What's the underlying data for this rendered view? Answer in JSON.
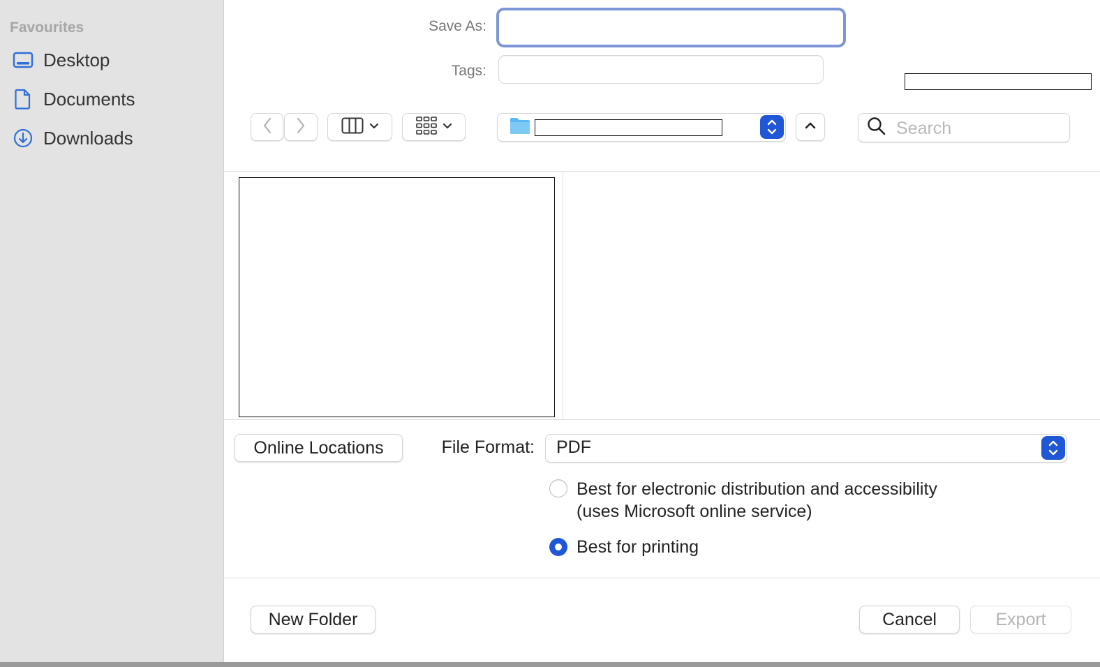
{
  "sidebar": {
    "heading": "Favourites",
    "items": [
      {
        "label": "Desktop",
        "icon": "desktop-icon"
      },
      {
        "label": "Documents",
        "icon": "document-icon"
      },
      {
        "label": "Downloads",
        "icon": "download-icon"
      }
    ]
  },
  "form": {
    "save_as_label": "Save As:",
    "save_as_value": "",
    "tags_label": "Tags:"
  },
  "toolbar": {
    "back_icon": "chevron-left-icon",
    "forward_icon": "chevron-right-icon",
    "column_view_icon": "columns-icon",
    "group_icon": "grid-icon",
    "location_icon": "folder-icon",
    "location_name": "",
    "expand_icon": "chevron-up-icon",
    "search_placeholder": "Search"
  },
  "options": {
    "online_locations_label": "Online Locations",
    "file_format_label": "File Format:",
    "file_format_value": "PDF",
    "radio_options": [
      {
        "line1": "Best for electronic distribution and accessibility",
        "line2": "(uses Microsoft online service)",
        "selected": false
      },
      {
        "line1": "Best for printing",
        "line2": "",
        "selected": true
      }
    ]
  },
  "footer": {
    "new_folder_label": "New Folder",
    "cancel_label": "Cancel",
    "export_label": "Export",
    "export_enabled": false
  },
  "colors": {
    "accent": "#1f57d6",
    "focus_ring": "#7d96d7",
    "sidebar_bg": "#e3e3e3",
    "sidebar_icon": "#2f6fd8",
    "folder": "#5cb8f2"
  }
}
